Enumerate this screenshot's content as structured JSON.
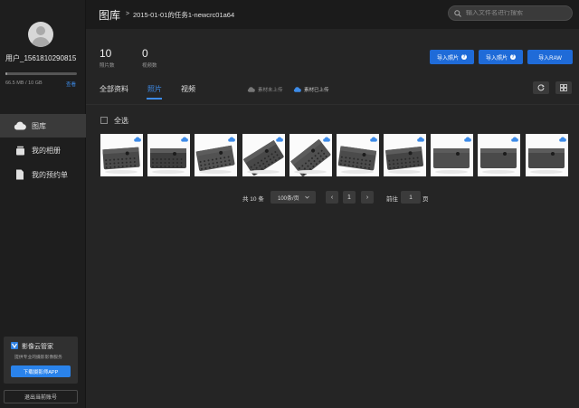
{
  "sidebar": {
    "username": "用户_1561810290815",
    "storage_text": "66.5 MB / 10 GB",
    "storage_link": "查看",
    "storage_progress": 0.007,
    "nav": [
      {
        "label": "图库",
        "icon": "cloud-icon",
        "active": true
      },
      {
        "label": "我的相册",
        "icon": "album-icon",
        "active": false
      },
      {
        "label": "我的预约单",
        "icon": "document-icon",
        "active": false
      }
    ],
    "promo": {
      "title": "影像云管家",
      "subtitle": "提供专业的摄影影像服务",
      "button": "下载摄影师APP"
    },
    "logout": "退出当前账号"
  },
  "header": {
    "title": "图库",
    "separator": ">",
    "breadcrumb": "2015-01-01的任务1-newcrc01a64",
    "search_placeholder": "输入文件名进行搜索"
  },
  "stats": [
    {
      "num": "10",
      "label": "照片数"
    },
    {
      "num": "0",
      "label": "视频数"
    }
  ],
  "import_buttons": [
    "导入照片",
    "导入照片",
    "导入RAW"
  ],
  "help_glyph": "?",
  "tabs": [
    "全部资料",
    "照片",
    "视频"
  ],
  "filters": [
    "素材未上传",
    "素材已上传"
  ],
  "select_all": "全选",
  "photos_count": 10,
  "pagination": {
    "total": "共 10 条",
    "page_size": "100条/页",
    "prev": "‹",
    "current": "1",
    "next": "›",
    "goto": "前往",
    "goto_value": "1",
    "page_unit": "页"
  },
  "colors": {
    "accent": "#3d8be8",
    "button_blue": "#1f6bd8",
    "bg": "#252525",
    "sidebar_bg": "#1e1e1e"
  }
}
